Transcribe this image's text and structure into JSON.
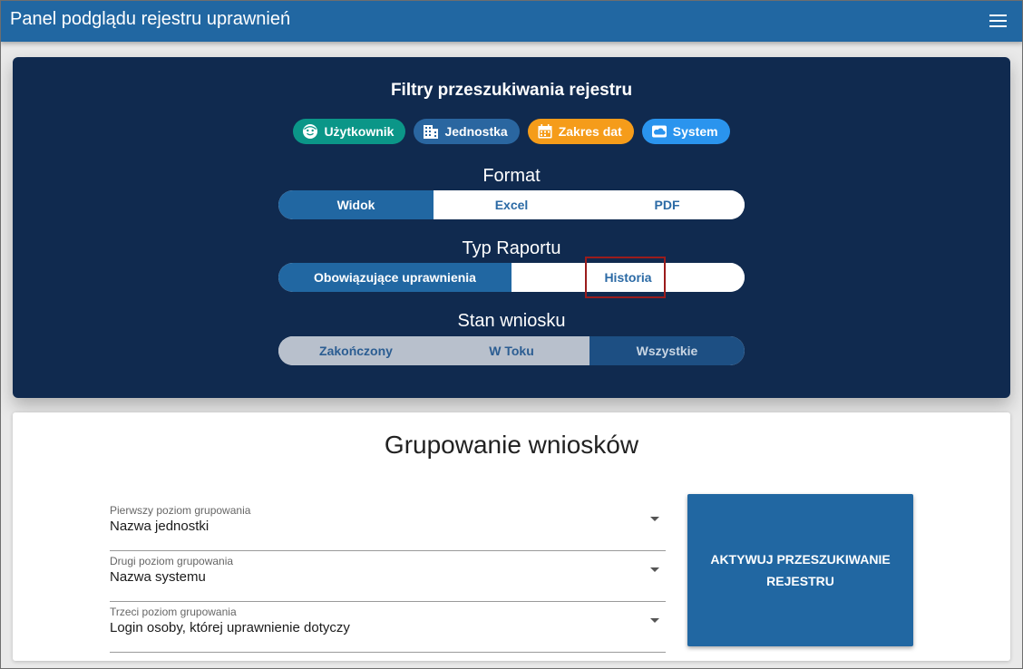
{
  "appbar": {
    "title": "Panel podglądu rejestru uprawnień",
    "menu_icon": "hamburger-menu-icon"
  },
  "filters": {
    "title": "Filtry przeszukiwania rejestru",
    "chips": [
      {
        "label": "Użytkownik",
        "icon": "user-face-icon",
        "color": "#0b9688"
      },
      {
        "label": "Jednostka",
        "icon": "building-icon",
        "color": "#2a66a0"
      },
      {
        "label": "Zakres dat",
        "icon": "calendar-icon",
        "color": "#f59c1a"
      },
      {
        "label": "System",
        "icon": "cloud-icon",
        "color": "#2a94ee"
      }
    ],
    "format": {
      "label": "Format",
      "options": [
        "Widok",
        "Excel",
        "PDF"
      ],
      "selected": "Widok"
    },
    "report_type": {
      "label": "Typ Raportu",
      "options": [
        "Obowiązujące uprawnienia",
        "Historia"
      ],
      "selected": "Obowiązujące uprawnienia"
    },
    "request_state": {
      "label": "Stan wniosku",
      "options": [
        "Zakończony",
        "W Toku",
        "Wszystkie"
      ],
      "selected": "Wszystkie"
    }
  },
  "grouping": {
    "title": "Grupowanie wniosków",
    "levels": [
      {
        "label": "Pierwszy poziom grupowania",
        "value": "Nazwa jednostki"
      },
      {
        "label": "Drugi poziom grupowania",
        "value": "Nazwa systemu"
      },
      {
        "label": "Trzeci poziom grupowania",
        "value": "Login osoby, której uprawnienie dotyczy"
      }
    ],
    "activate_button": "AKTYWUJ PRZESZUKIWANIE REJESTRU"
  },
  "colors": {
    "primary": "#2167a2",
    "navy_panel": "#102a4f",
    "highlight": "#9b1c1c"
  }
}
